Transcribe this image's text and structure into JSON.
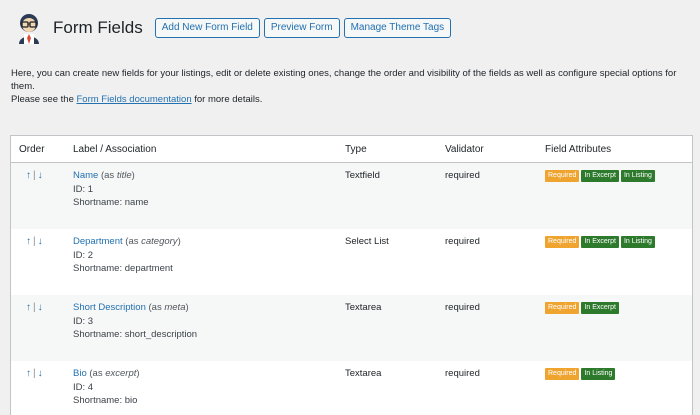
{
  "header": {
    "title": "Form Fields",
    "buttons": [
      "Add New Form Field",
      "Preview Form",
      "Manage Theme Tags"
    ]
  },
  "intro": {
    "line1": "Here, you can create new fields for your listings, edit or delete existing ones, change the order and visibility of the fields as well as configure special options for them.",
    "line2_prefix": "Please see the ",
    "link": "Form Fields documentation",
    "line2_suffix": " for more details."
  },
  "table": {
    "columns": [
      "Order",
      "Label / Association",
      "Type",
      "Validator",
      "Field Attributes"
    ],
    "rows": [
      {
        "name": "Name",
        "assoc_pre": "(as ",
        "assoc": "title",
        "assoc_post": ")",
        "id": "ID: 1",
        "short": "Shortname: name",
        "type": "Textfield",
        "validator": "required",
        "attrs": [
          "Required",
          "In Excerpt",
          "In Listing"
        ]
      },
      {
        "name": "Department",
        "assoc_pre": "(as ",
        "assoc": "category",
        "assoc_post": ")",
        "id": "ID: 2",
        "short": "Shortname: department",
        "type": "Select List",
        "validator": "required",
        "attrs": [
          "Required",
          "In Excerpt",
          "In Listing"
        ]
      },
      {
        "name": "Short Description",
        "assoc_pre": "(as ",
        "assoc": "meta",
        "assoc_post": ")",
        "id": "ID: 3",
        "short": "Shortname: short_description",
        "type": "Textarea",
        "validator": "required",
        "attrs": [
          "Required",
          "In Excerpt"
        ]
      },
      {
        "name": "Bio",
        "assoc_pre": "(as ",
        "assoc": "excerpt",
        "assoc_post": ")",
        "id": "ID: 4",
        "short": "Shortname: bio",
        "type": "Textarea",
        "validator": "required",
        "attrs": [
          "Required",
          "In Listing"
        ]
      }
    ],
    "order_up": "↑",
    "order_sep": "|",
    "order_down": "↓"
  },
  "colors": {
    "accent": "#2271b1",
    "required": "#f0a430",
    "excerpt": "#2d7a2d",
    "listing": "#2d7a2d"
  }
}
